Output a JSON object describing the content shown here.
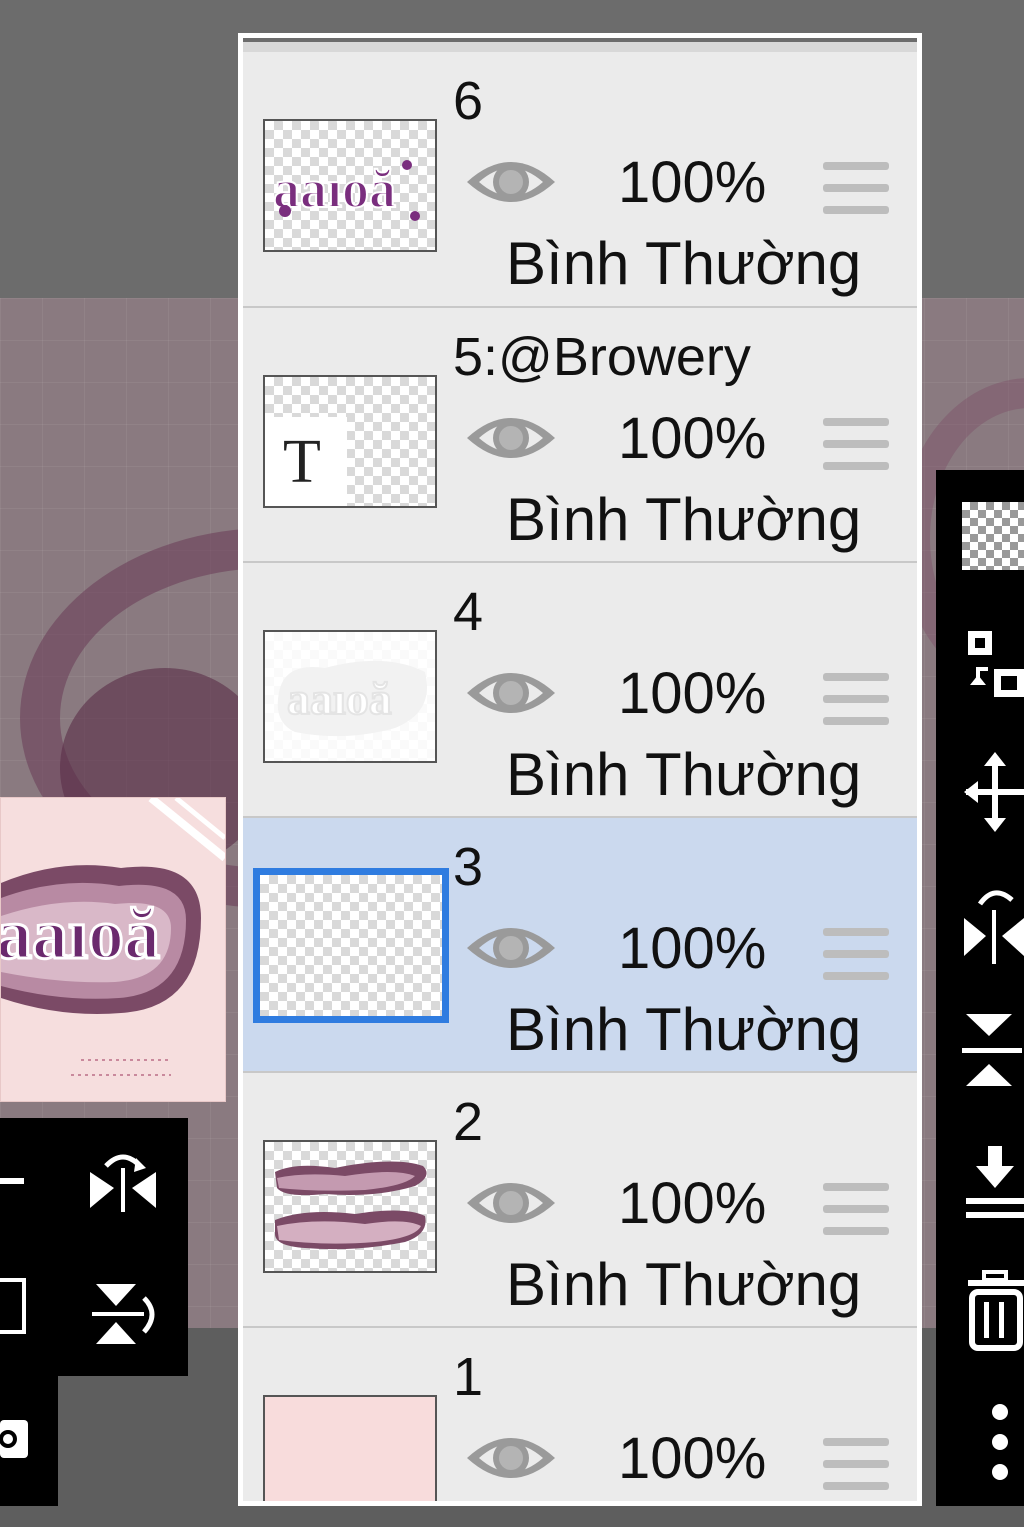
{
  "layers": [
    {
      "name": "6",
      "opacity": "100%",
      "blend_mode": "Bình Thường",
      "selected": false,
      "thumbnail": "purple-lettering"
    },
    {
      "name": "5:@Browery",
      "opacity": "100%",
      "blend_mode": "Bình Thường",
      "selected": false,
      "thumbnail": "text-layer",
      "thumb_glyph": "T"
    },
    {
      "name": "4",
      "opacity": "100%",
      "blend_mode": "Bình Thường",
      "selected": false,
      "thumbnail": "white-outline"
    },
    {
      "name": "3",
      "opacity": "100%",
      "blend_mode": "Bình Thường",
      "selected": true,
      "thumbnail": "empty"
    },
    {
      "name": "2",
      "opacity": "100%",
      "blend_mode": "Bình Thường",
      "selected": false,
      "thumbnail": "pink-waves"
    },
    {
      "name": "1",
      "opacity": "100%",
      "blend_mode": "Bình Thường",
      "selected": false,
      "thumbnail": "solid-pink"
    }
  ],
  "colors": {
    "selected_row": "#cbd9ee",
    "selected_border": "#2f7ce0",
    "layer1_fill": "#f8dcdc"
  },
  "right_toolbar_icons": [
    "transparency-icon",
    "swap-layers-icon",
    "move-icon",
    "flip-horizontal-icon",
    "flip-vertical-icon",
    "merge-down-icon",
    "trash-icon",
    "more-vertical-icon"
  ],
  "left_toolbar_icons": [
    "minus-icon",
    "flip-horizontal-icon",
    "add-layer-icon",
    "flip-vertical-icon",
    "camera-icon"
  ]
}
